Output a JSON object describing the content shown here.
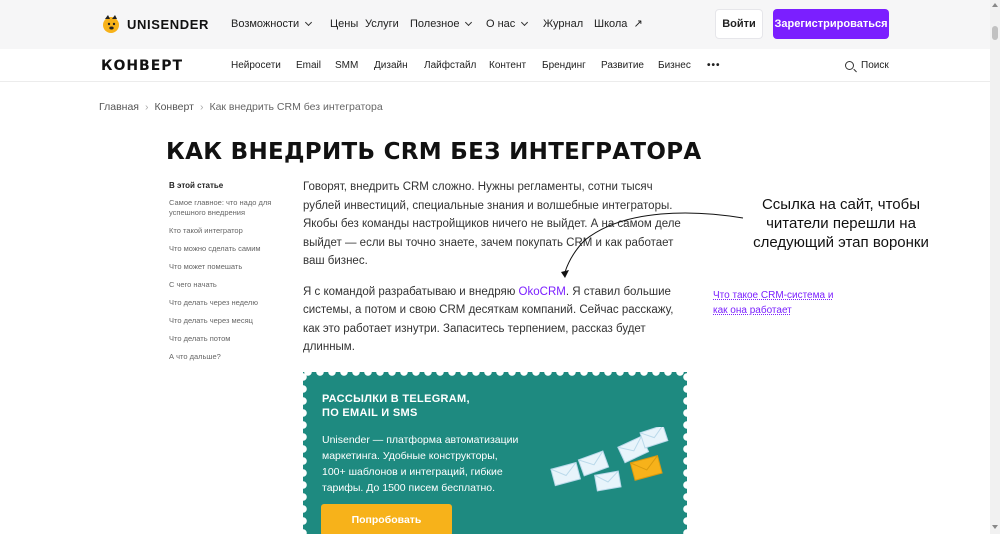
{
  "header": {
    "logo_text": "UNISENDER",
    "nav": [
      {
        "label": "Возможности",
        "dropdown": true
      },
      {
        "label": "Цены",
        "dropdown": false
      },
      {
        "label": "Услуги",
        "dropdown": false
      },
      {
        "label": "Полезное",
        "dropdown": true
      },
      {
        "label": "О нас",
        "dropdown": true
      },
      {
        "label": "Журнал",
        "dropdown": false
      },
      {
        "label": "Школа",
        "dropdown": false,
        "external": true
      }
    ],
    "login_label": "Войти",
    "register_label": "Зарегистрироваться",
    "accent_color": "#7b1fff"
  },
  "subheader": {
    "brand": "КОНВЕРТ",
    "nav": [
      "Нейросети",
      "Email",
      "SMM",
      "Дизайн",
      "Лайфстайл",
      "Контент",
      "Брендинг",
      "Развитие",
      "Бизнес"
    ],
    "more_label": "•••",
    "search_label": "Поиск"
  },
  "breadcrumb": [
    "Главная",
    "Конверт",
    "Как внедрить CRM без интегратора"
  ],
  "page_title": "КАК ВНЕДРИТЬ CRM БЕЗ ИНТЕГРАТОРА",
  "toc": {
    "heading": "В этой статье",
    "items": [
      "Самое главное: что надо для успешного внедрения",
      "Кто такой интегратор",
      "Что можно сделать самим",
      "Что может помешать",
      "С чего начать",
      "Что делать через неделю",
      "Что делать через месяц",
      "Что делать потом",
      "А что дальше?"
    ]
  },
  "article": {
    "p1": "Говорят, внедрить CRM сложно. Нужны регламенты, сотни тысяч рублей инвестиций, специальные знания и волшебные интеграторы. Якобы без команды настройщиков ничего не выйдет. А на самом деле выйдет — если вы точно знаете, зачем покупать CRM и как работает ваш бизнес.",
    "p2_before": "Я с командой разрабатываю и внедряю ",
    "p2_link": "OkoCRM",
    "p2_after": ". Я ставил большие системы, а потом и свою CRM десяткам компаний. Сейчас расскажу, как это работает изнутри. Запаситесь терпением, рассказ будет длинным."
  },
  "annotation": "Ссылка на сайт, чтобы читатели перешли на следующий этап воронки",
  "side_link": "Что такое CRM-система и как она работает",
  "promo": {
    "title_line1": "РАССЫЛКИ В TELEGRAM,",
    "title_line2": "ПО EMAIL И SMS",
    "text": "Unisender — платформа автоматизации маркетинга. Удобные конструкторы, 100+ шаблонов и интеграций, гибкие тарифы. До 1500 писем бесплатно.",
    "button_label": "Попробовать",
    "bg_color": "#1e8a80",
    "button_color": "#f7b21a"
  }
}
